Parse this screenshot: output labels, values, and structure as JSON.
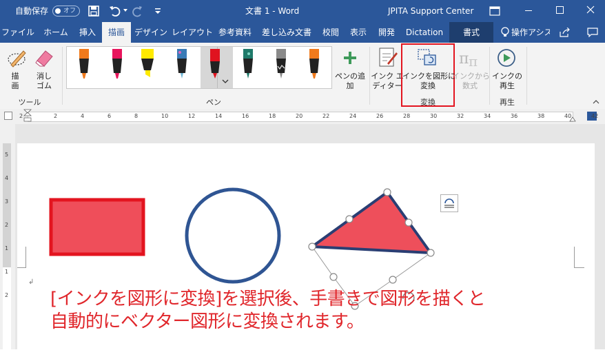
{
  "titlebar": {
    "autosave_label": "自動保存",
    "autosave_state": "オフ",
    "doc_title": "文書 1  -  Word",
    "account": "JPITA Support Center",
    "colors": {
      "bar": "#2b579a"
    }
  },
  "tabs": [
    "ファイル",
    "ホーム",
    "挿入",
    "描画",
    "デザイン",
    "レイアウト",
    "参考資料",
    "差し込み文書",
    "校閲",
    "表示",
    "開発",
    "Dictation",
    "書式"
  ],
  "active_tab": "描画",
  "tell_me": "操作アシス",
  "ribbon": {
    "tools_group": {
      "label": "ツール",
      "draw": "描\n画",
      "eraser": "消し\nゴム"
    },
    "pens_group": {
      "label": "ペン",
      "add_pen": "ペンの追\n加",
      "pens": [
        {
          "color": "#f07a1c",
          "icon": "marker-pen"
        },
        {
          "color": "#e8155d",
          "icon": "marker-pen"
        },
        {
          "color": "#ffea00",
          "icon": "highlighter-pen"
        },
        {
          "color": "#3a7bb6",
          "icon": "galaxy-pen"
        },
        {
          "color": "#e0131f",
          "icon": "pencil-pen"
        },
        {
          "color": "#1f7a6a",
          "icon": "galaxy-pen"
        },
        {
          "color": "#8a8a8a",
          "icon": "pencil-pen"
        },
        {
          "color": "#f07a1c",
          "icon": "marker-pen"
        }
      ]
    },
    "ink_editor": "インク エ\nディター",
    "convert_group": {
      "label": "変換",
      "ink_to_shape": "インクを図形に\n変換",
      "ink_to_math": "インクから\n数式"
    },
    "replay_group": {
      "label": "再生",
      "replay": "インクの\n再生"
    }
  },
  "ruler": {
    "h_numbers": [
      "2",
      "2",
      "4",
      "6",
      "8",
      "10",
      "12",
      "14",
      "16",
      "18",
      "20",
      "22",
      "24",
      "26",
      "28",
      "30",
      "32",
      "34",
      "36",
      "38",
      "40",
      "42"
    ],
    "v_numbers": [
      "5",
      "4",
      "3",
      "2",
      "1",
      "1",
      "2"
    ]
  },
  "document": {
    "caption_line1": "[インクを図形に変換]を選択後、手書きで図形を描くと",
    "caption_line2": "自動的にベクター図形に変換されます。",
    "shape_colors": {
      "rect_fill": "#ef4e5a",
      "rect_border": "#e3141f",
      "circle": "#2f5593",
      "triangle_fill": "#ee4f5b",
      "triangle_border": "#2a3e73"
    }
  }
}
